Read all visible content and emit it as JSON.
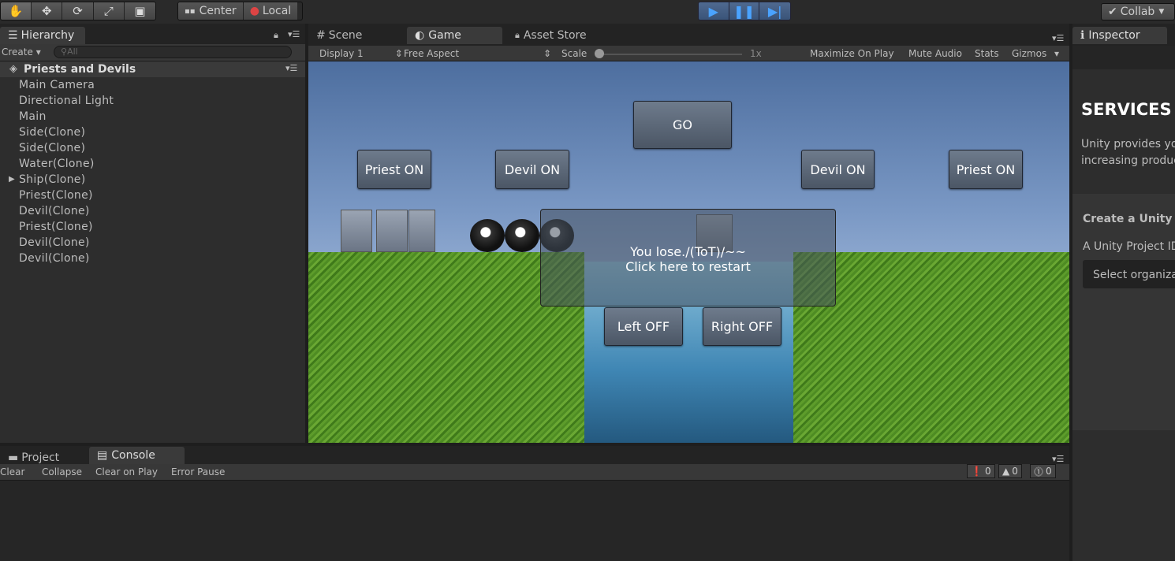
{
  "toolbar": {
    "tools": [
      {
        "name": "hand-tool",
        "glyph": "✋"
      },
      {
        "name": "move-tool",
        "glyph": "✥"
      },
      {
        "name": "rotate-tool",
        "glyph": "⟳"
      },
      {
        "name": "scale-tool",
        "glyph": "⤢"
      },
      {
        "name": "rect-tool",
        "glyph": "▣"
      }
    ],
    "pivot_label": "Center",
    "space_label": "Local",
    "collab_label": "Collab"
  },
  "hierarchy": {
    "tab_label": "Hierarchy",
    "create_label": "Create",
    "search_placeholder": "All",
    "scene_name": "Priests and Devils",
    "items": [
      "Main Camera",
      "Directional Light",
      "Main",
      "Side(Clone)",
      "Side(Clone)",
      "Water(Clone)",
      "Ship(Clone)",
      "Priest(Clone)",
      "Devil(Clone)",
      "Priest(Clone)",
      "Devil(Clone)",
      "Devil(Clone)"
    ]
  },
  "game_panel": {
    "tabs": [
      "Scene",
      "Game",
      "Asset Store"
    ],
    "display": "Display 1",
    "aspect": "Free Aspect",
    "scale_label": "Scale",
    "scale_value": "1x",
    "options": [
      "Maximize On Play",
      "Mute Audio",
      "Stats",
      "Gizmos"
    ]
  },
  "game_ui": {
    "go": "GO",
    "left_priest": "Priest ON",
    "left_devil": "Devil ON",
    "right_devil": "Devil ON",
    "right_priest": "Priest ON",
    "message_line1": "You lose./(ToT)/~~",
    "message_line2": "Click here to restart",
    "left_off": "Left OFF",
    "right_off": "Right OFF"
  },
  "inspector": {
    "tab_label": "Inspector",
    "services_title": "SERVICES",
    "services_text_1": "Unity provides you",
    "services_text_2": "increasing produc",
    "create_label": "Create a Unity Pro",
    "project_id_label": "A Unity Project ID",
    "select_org": "Select organiza"
  },
  "bottom": {
    "tabs": [
      "Project",
      "Console"
    ],
    "console_buttons": [
      "Clear",
      "Collapse",
      "Clear on Play",
      "Error Pause"
    ],
    "counts": {
      "info": "0",
      "warning": "0",
      "error": "0"
    }
  }
}
